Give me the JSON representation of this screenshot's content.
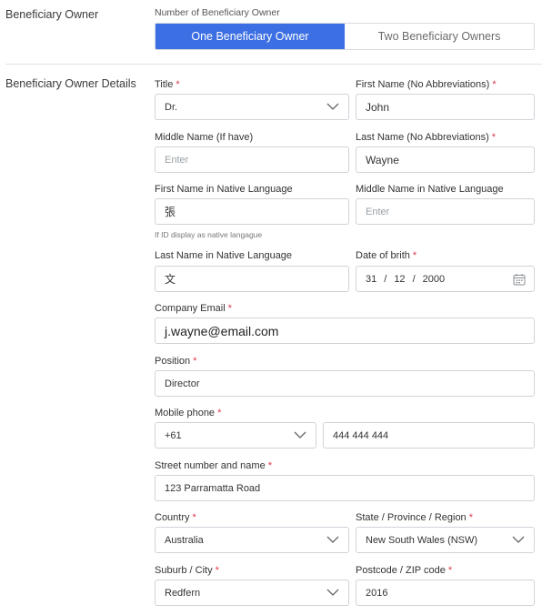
{
  "section1": {
    "label": "Beneficiary Owner",
    "field_label": "Number of Beneficiary Owner",
    "options": [
      "One Beneficiary Owner",
      "Two Beneficiary Owners"
    ],
    "selected": "One Beneficiary Owner",
    "active_color": "#3c6fe3"
  },
  "section2": {
    "label": "Beneficiary Owner Details"
  },
  "required_marker": "*",
  "required_color": "#e0394a",
  "fields": {
    "title": {
      "label": "Title",
      "value": "Dr."
    },
    "first_name": {
      "label": "First Name (No Abbreviations)",
      "value": "John"
    },
    "middle_name": {
      "label": "Middle Name (If have)",
      "placeholder": "Enter"
    },
    "last_name": {
      "label": "Last Name (No Abbreviations)",
      "value": "Wayne"
    },
    "first_name_native": {
      "label": "First Name in Native Language",
      "value": "張",
      "hint": "If ID display as native langague"
    },
    "middle_name_native": {
      "label": "Middle Name in Native Language",
      "placeholder": "Enter"
    },
    "last_name_native": {
      "label": "Last Name in Native Language",
      "value": "文"
    },
    "dob": {
      "label": "Date of brith",
      "day": "31",
      "month": "12",
      "year": "2000",
      "separator": "/"
    },
    "company_email": {
      "label": "Company Email",
      "value": "j.wayne@email.com"
    },
    "position": {
      "label": "Position",
      "value": "Director"
    },
    "mobile": {
      "label": "Mobile phone",
      "code": "+61",
      "number": "444 444 444"
    },
    "street": {
      "label": "Street number and name",
      "value": "123 Parramatta Road"
    },
    "country": {
      "label": "Country",
      "value": "Australia"
    },
    "state": {
      "label": "State / Province / Region",
      "value": "New South Wales (NSW)"
    },
    "suburb": {
      "label": "Suburb / City",
      "value": "Redfern"
    },
    "postcode": {
      "label": "Postcode / ZIP code",
      "value": "2016"
    }
  },
  "icons": {
    "dropdown": "chevron-down-icon",
    "date": "calendar-icon"
  }
}
